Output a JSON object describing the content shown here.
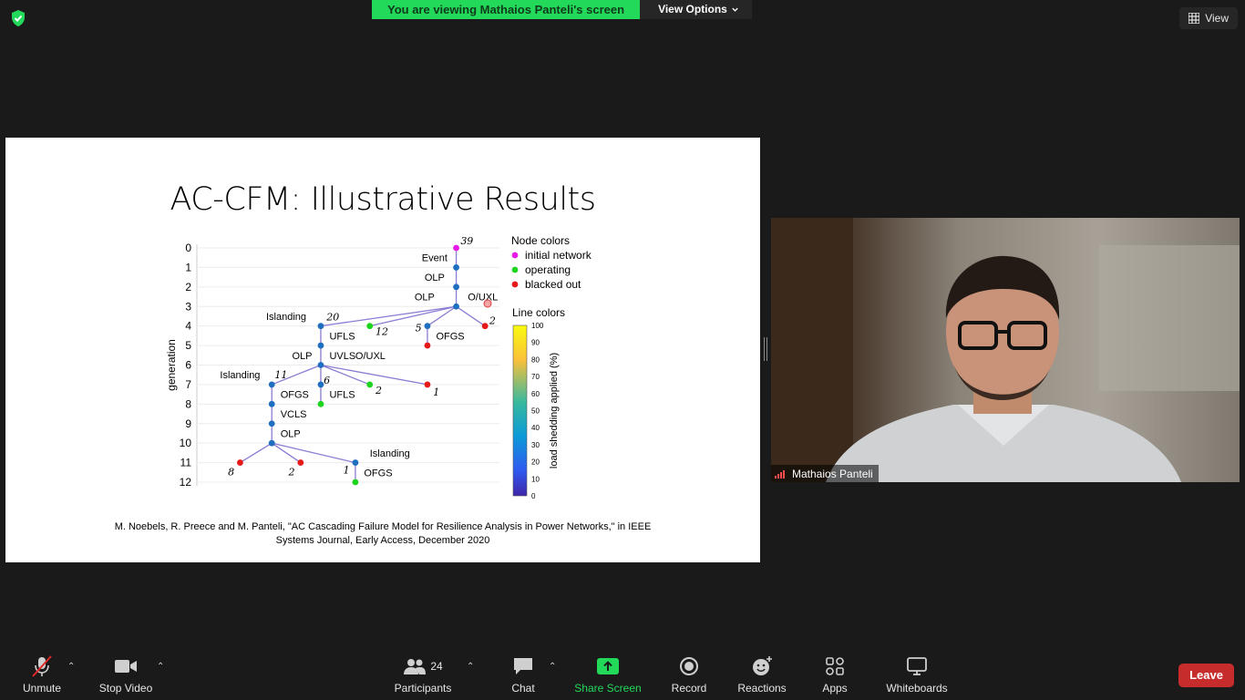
{
  "banner": {
    "text": "You are viewing Mathaios Panteli's screen",
    "options_label": "View Options"
  },
  "view_button": {
    "label": "View"
  },
  "slide": {
    "title": "AC-CFM: Illustrative Results",
    "citation_line1": "M. Noebels, R. Preece and M. Panteli, \"AC Cascading Failure Model for Resilience Analysis in Power Networks,\" in IEEE",
    "citation_line2": "Systems Journal, Early Access, December 2020"
  },
  "chart_data": {
    "type": "tree-diagram",
    "ylabel": "generation",
    "y_ticks": [
      "0",
      "1",
      "2",
      "3",
      "4",
      "5",
      "6",
      "7",
      "8",
      "9",
      "10",
      "11",
      "12"
    ],
    "ylim": [
      0,
      12
    ],
    "colors": {
      "initial": "#e619e6",
      "operating": "#1ed41e",
      "blacked": "#e61919",
      "internal": "#1f6fc0",
      "edge": "#8a7bd4"
    },
    "legend_nodes": {
      "title": "Node colors",
      "items": [
        {
          "label": "initial network",
          "color": "#e619e6"
        },
        {
          "label": "operating",
          "color": "#1ed41e"
        },
        {
          "label": "blacked out",
          "color": "#e61919"
        }
      ]
    },
    "legend_lines": {
      "title": "Line colors",
      "axis_label": "load shedding applied (%)",
      "ticks": [
        "100",
        "90",
        "80",
        "70",
        "60",
        "50",
        "40",
        "30",
        "20",
        "10",
        "0"
      ]
    },
    "nodes": [
      {
        "id": "n39",
        "gen": 0,
        "col": 9.0,
        "color": "initial"
      },
      {
        "id": "a1",
        "gen": 1,
        "col": 9.0,
        "color": "internal"
      },
      {
        "id": "a2",
        "gen": 2,
        "col": 9.0,
        "color": "internal"
      },
      {
        "id": "a3",
        "gen": 3,
        "col": 9.0,
        "color": "internal"
      },
      {
        "id": "r2",
        "gen": 4,
        "col": 10.0,
        "color": "blacked"
      },
      {
        "id": "b4",
        "gen": 4,
        "col": 8.0,
        "color": "internal"
      },
      {
        "id": "b5",
        "gen": 5,
        "col": 8.0,
        "color": "blacked"
      },
      {
        "id": "g12",
        "gen": 4,
        "col": 6.0,
        "color": "operating"
      },
      {
        "id": "c4",
        "gen": 4,
        "col": 4.3,
        "color": "internal"
      },
      {
        "id": "c5",
        "gen": 5,
        "col": 4.3,
        "color": "internal"
      },
      {
        "id": "c6",
        "gen": 6,
        "col": 4.3,
        "color": "internal"
      },
      {
        "id": "d7",
        "gen": 7,
        "col": 4.3,
        "color": "internal"
      },
      {
        "id": "d8",
        "gen": 8,
        "col": 4.3,
        "color": "operating"
      },
      {
        "id": "e7",
        "gen": 7,
        "col": 6.0,
        "color": "operating"
      },
      {
        "id": "f7",
        "gen": 7,
        "col": 8.0,
        "color": "blacked"
      },
      {
        "id": "h7",
        "gen": 7,
        "col": 2.6,
        "color": "internal"
      },
      {
        "id": "h8",
        "gen": 8,
        "col": 2.6,
        "color": "internal"
      },
      {
        "id": "h9",
        "gen": 9,
        "col": 2.6,
        "color": "internal"
      },
      {
        "id": "h10",
        "gen": 10,
        "col": 2.6,
        "color": "internal"
      },
      {
        "id": "k11",
        "gen": 11,
        "col": 1.5,
        "color": "blacked"
      },
      {
        "id": "m11",
        "gen": 11,
        "col": 3.6,
        "color": "blacked"
      },
      {
        "id": "p11",
        "gen": 11,
        "col": 5.5,
        "color": "internal"
      },
      {
        "id": "p12",
        "gen": 12,
        "col": 5.5,
        "color": "operating"
      }
    ],
    "edges": [
      [
        "n39",
        "a1"
      ],
      [
        "a1",
        "a2"
      ],
      [
        "a2",
        "a3"
      ],
      [
        "a3",
        "r2"
      ],
      [
        "a3",
        "b4"
      ],
      [
        "b4",
        "b5"
      ],
      [
        "a3",
        "g12"
      ],
      [
        "a3",
        "c4"
      ],
      [
        "c4",
        "c5"
      ],
      [
        "c5",
        "c6"
      ],
      [
        "c6",
        "d7"
      ],
      [
        "d7",
        "d8"
      ],
      [
        "c6",
        "e7"
      ],
      [
        "c6",
        "f7"
      ],
      [
        "c6",
        "h7"
      ],
      [
        "h7",
        "h8"
      ],
      [
        "h8",
        "h9"
      ],
      [
        "h9",
        "h10"
      ],
      [
        "h10",
        "k11"
      ],
      [
        "h10",
        "m11"
      ],
      [
        "h10",
        "p11"
      ],
      [
        "p11",
        "p12"
      ]
    ],
    "annotations": [
      {
        "text": "39",
        "gen": 0,
        "col": 9.15,
        "style": "italic",
        "anchor": "start",
        "dy": -4
      },
      {
        "text": "Event",
        "gen": 0.5,
        "col": 8.25,
        "style": "normal",
        "anchor": "middle",
        "dy": 4
      },
      {
        "text": "OLP",
        "gen": 1.5,
        "col": 8.25,
        "style": "normal",
        "anchor": "middle",
        "dy": 4
      },
      {
        "text": "OLP",
        "gen": 2.5,
        "col": 8.25,
        "style": "normal",
        "anchor": "end",
        "dy": 4
      },
      {
        "text": "O/UXL",
        "gen": 2.5,
        "col": 9.4,
        "style": "normal",
        "anchor": "start",
        "dy": 4
      },
      {
        "text": "2",
        "gen": 4,
        "col": 10.15,
        "style": "italic",
        "anchor": "start",
        "dy": -2
      },
      {
        "text": "5",
        "gen": 4,
        "col": 7.8,
        "style": "italic",
        "anchor": "end",
        "dy": 6
      },
      {
        "text": "OFGS",
        "gen": 4.5,
        "col": 8.3,
        "style": "normal",
        "anchor": "start",
        "dy": 4
      },
      {
        "text": "12",
        "gen": 4,
        "col": 6.2,
        "style": "italic",
        "anchor": "start",
        "dy": 10
      },
      {
        "text": "Islanding",
        "gen": 3.5,
        "col": 3.1,
        "style": "normal",
        "anchor": "middle",
        "dy": 4
      },
      {
        "text": "20",
        "gen": 4,
        "col": 4.5,
        "style": "italic",
        "anchor": "start",
        "dy": -6
      },
      {
        "text": "UFLS",
        "gen": 4.5,
        "col": 4.6,
        "style": "normal",
        "anchor": "start",
        "dy": 4
      },
      {
        "text": "OLP",
        "gen": 5.5,
        "col": 4.0,
        "style": "normal",
        "anchor": "end",
        "dy": 4
      },
      {
        "text": "UVLS",
        "gen": 5.5,
        "col": 4.6,
        "style": "normal",
        "anchor": "start",
        "dy": 4
      },
      {
        "text": "O/UXL",
        "gen": 5.5,
        "col": 5.5,
        "style": "normal",
        "anchor": "start",
        "dy": 4
      },
      {
        "text": "Islanding",
        "gen": 6.5,
        "col": 1.5,
        "style": "normal",
        "anchor": "middle",
        "dy": 4
      },
      {
        "text": "11",
        "gen": 6.5,
        "col": 2.7,
        "style": "italic",
        "anchor": "start",
        "dy": 4
      },
      {
        "text": "6",
        "gen": 6.5,
        "col": 4.4,
        "style": "italic",
        "anchor": "start",
        "dy": 10
      },
      {
        "text": "OFGS",
        "gen": 7.5,
        "col": 2.9,
        "style": "normal",
        "anchor": "start",
        "dy": 4
      },
      {
        "text": "UFLS",
        "gen": 7.5,
        "col": 4.6,
        "style": "normal",
        "anchor": "start",
        "dy": 4
      },
      {
        "text": "2",
        "gen": 7,
        "col": 6.2,
        "style": "italic",
        "anchor": "start",
        "dy": 10
      },
      {
        "text": "1",
        "gen": 7,
        "col": 8.2,
        "style": "italic",
        "anchor": "start",
        "dy": 12
      },
      {
        "text": "VCLS",
        "gen": 8.5,
        "col": 2.9,
        "style": "normal",
        "anchor": "start",
        "dy": 4
      },
      {
        "text": "OLP",
        "gen": 9.5,
        "col": 2.9,
        "style": "normal",
        "anchor": "start",
        "dy": 4
      },
      {
        "text": "Islanding",
        "gen": 10.5,
        "col": 6.0,
        "style": "normal",
        "anchor": "start",
        "dy": 4
      },
      {
        "text": "8",
        "gen": 11,
        "col": 1.3,
        "style": "italic",
        "anchor": "end",
        "dy": 14
      },
      {
        "text": "2",
        "gen": 11,
        "col": 3.4,
        "style": "italic",
        "anchor": "end",
        "dy": 14
      },
      {
        "text": "1",
        "gen": 11,
        "col": 5.3,
        "style": "italic",
        "anchor": "end",
        "dy": 12
      },
      {
        "text": "OFGS",
        "gen": 11.5,
        "col": 5.8,
        "style": "normal",
        "anchor": "start",
        "dy": 4
      }
    ]
  },
  "participant": {
    "name": "Mathaios Panteli"
  },
  "toolbar": {
    "unmute": "Unmute",
    "stop_video": "Stop Video",
    "participants": "Participants",
    "participants_count": "24",
    "chat": "Chat",
    "share_screen": "Share Screen",
    "record": "Record",
    "reactions": "Reactions",
    "apps": "Apps",
    "whiteboards": "Whiteboards",
    "leave": "Leave"
  }
}
